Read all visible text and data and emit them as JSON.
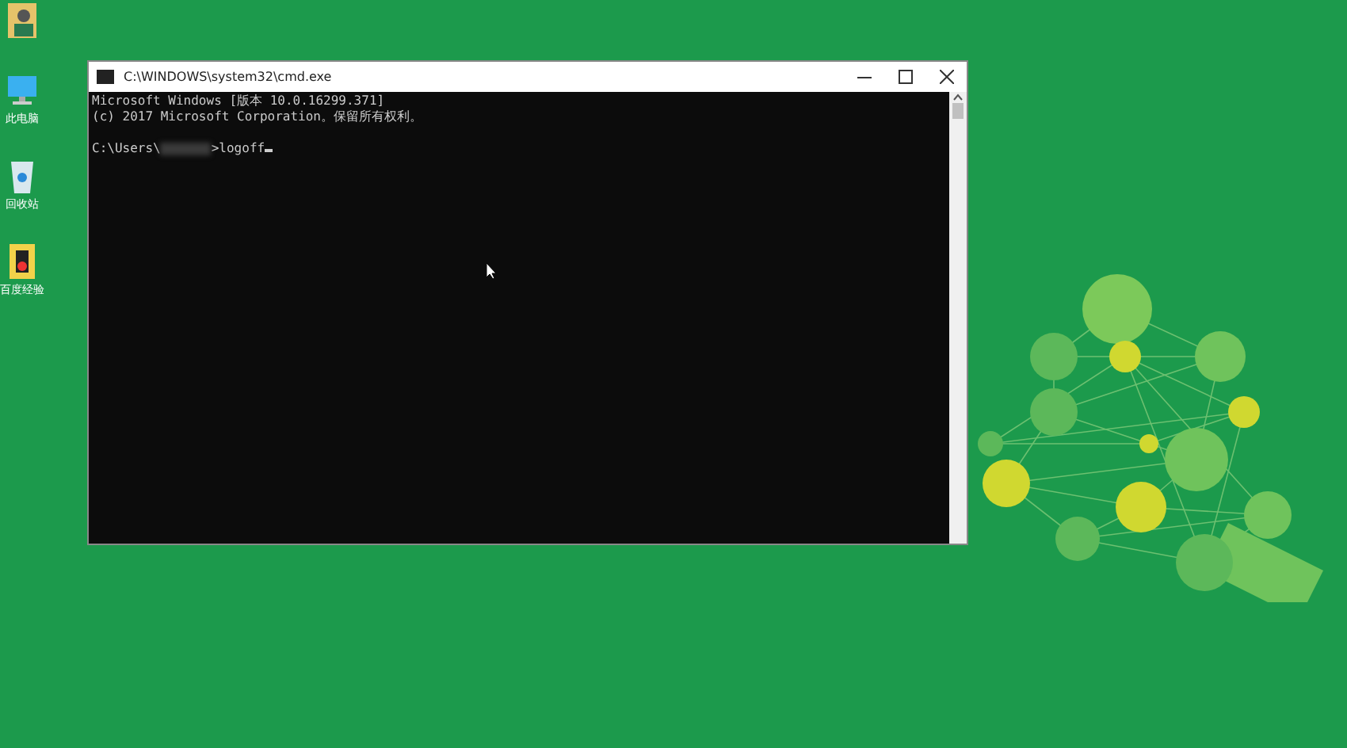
{
  "desktop_icons": [
    {
      "kind": "user"
    },
    {
      "label": "此电脑",
      "kind": "computer"
    },
    {
      "label": "回收站",
      "kind": "recycle"
    },
    {
      "label": "百度经验",
      "kind": "app"
    }
  ],
  "window": {
    "title": "C:\\WINDOWS\\system32\\cmd.exe",
    "controls": [
      {
        "kind": "minimize"
      },
      {
        "kind": "maximize"
      },
      {
        "kind": "close"
      }
    ]
  },
  "console": {
    "lines": [
      {
        "kind": "text",
        "text": "Microsoft Windows [版本 10.0.16299.371]"
      },
      {
        "kind": "text",
        "text": "(c) 2017 Microsoft Corporation。保留所有权利。"
      },
      {
        "kind": "blank"
      },
      {
        "kind": "prompt",
        "path": "C:\\Users\\",
        "command": ">logoff"
      }
    ]
  }
}
